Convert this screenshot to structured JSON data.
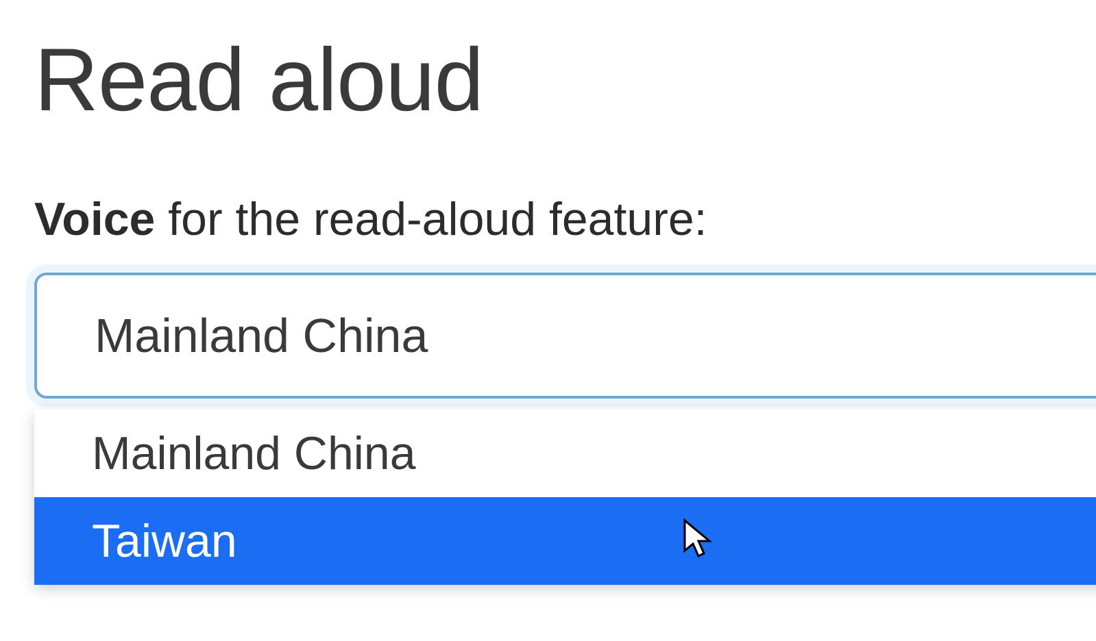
{
  "heading": "Read aloud",
  "label": {
    "bold": "Voice",
    "rest": " for the read-aloud feature:"
  },
  "select": {
    "selected": "Mainland China",
    "options": [
      {
        "label": "Mainland China",
        "highlighted": false
      },
      {
        "label": "Taiwan",
        "highlighted": true
      }
    ]
  }
}
